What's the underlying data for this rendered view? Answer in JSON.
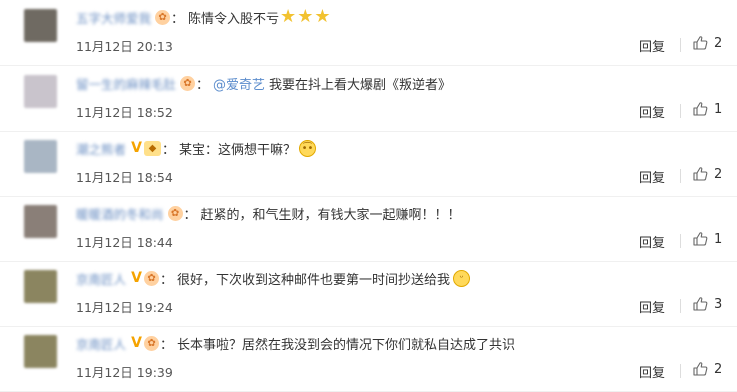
{
  "comments": [
    {
      "avatar_color": "#6f6a62",
      "username": "五字大师爱我",
      "badges": [
        "vip"
      ],
      "mention": "",
      "text": "陈情令入股不亏",
      "trailing_emoji": [
        "star-icon",
        "star-icon",
        "star-icon"
      ],
      "time": "11月12日 20:13",
      "reply": "回复",
      "likes": "2"
    },
    {
      "avatar_color": "#c9c4cc",
      "username": "留一生的麻辣毛肚",
      "badges": [
        "vip"
      ],
      "mention": "@爱奇艺",
      "text": "我要在抖上看大爆剧《叛逆者》",
      "trailing_emoji": [],
      "time": "11月12日 18:52",
      "reply": "回复",
      "likes": "1"
    },
    {
      "avatar_color": "#a9b6c4",
      "username": "潮之熊者",
      "badges": [
        "v",
        "gift"
      ],
      "mention": "",
      "text": "某宝：这俩想干嘛？",
      "trailing_emoji": [
        "thinking-face-icon"
      ],
      "time": "11月12日 18:54",
      "reply": "回复",
      "likes": "2"
    },
    {
      "avatar_color": "#8a7f78",
      "username": "暖暖酒的冬和尚",
      "badges": [
        "vip"
      ],
      "mention": "",
      "text": "赶紧的，和气生财，有钱大家一起赚啊！！！",
      "trailing_emoji": [],
      "time": "11月12日 18:44",
      "reply": "回复",
      "likes": "1"
    },
    {
      "avatar_color": "#8b8560",
      "username": "京南匠人",
      "badges": [
        "v",
        "vip"
      ],
      "mention": "",
      "text": "很好，下次收到这种邮件也要第一时间抄送给我",
      "trailing_emoji": [
        "cat-face-icon"
      ],
      "time": "11月12日 19:24",
      "reply": "回复",
      "likes": "3"
    },
    {
      "avatar_color": "#8b8560",
      "username": "京南匠人",
      "badges": [
        "v",
        "vip"
      ],
      "mention": "",
      "text": "长本事啦？居然在我没到会的情况下你们就私自达成了共识",
      "trailing_emoji": [],
      "time": "11月12日 19:39",
      "reply": "回复",
      "likes": "2"
    }
  ]
}
